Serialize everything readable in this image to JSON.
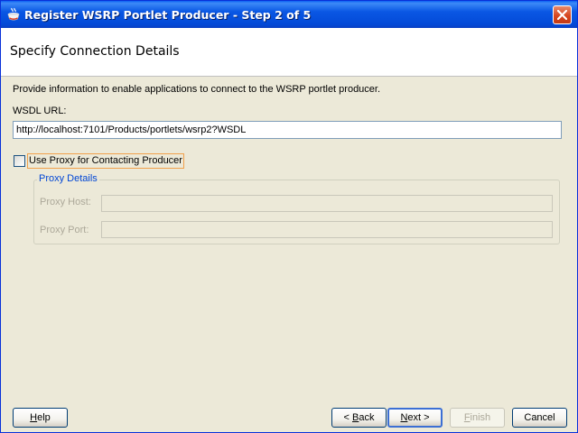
{
  "window": {
    "title": "Register WSRP Portlet Producer - Step 2 of 5"
  },
  "header": {
    "title": "Specify Connection Details"
  },
  "form": {
    "description": "Provide information to enable applications to connect to the WSRP portlet producer.",
    "wsdl_label": "WSDL URL:",
    "wsdl_value": "http://localhost:7101/Products/portlets/wsrp2?WSDL",
    "use_proxy_label": "Use Proxy for Contacting Producer",
    "use_proxy_checked": false,
    "proxy_details": {
      "legend": "Proxy Details",
      "host_label": "Proxy Host:",
      "host_value": "",
      "port_label": "Proxy Port:",
      "port_value": ""
    }
  },
  "buttons": {
    "help": {
      "mnemonic": "H",
      "rest": "elp"
    },
    "back": {
      "prefix": "< ",
      "mnemonic": "B",
      "rest": "ack"
    },
    "next": {
      "mnemonic": "N",
      "rest": "ext >"
    },
    "finish": {
      "mnemonic": "F",
      "rest": "inish",
      "enabled": false
    },
    "cancel": {
      "label": "Cancel"
    }
  },
  "colors": {
    "titlebar": "#0a57e4",
    "dialog_bg": "#ece9d8",
    "legend_text": "#0046d5",
    "focus_border": "#f0a04b"
  },
  "icons": {
    "title": "coffee-cup-icon",
    "close": "close-icon"
  }
}
